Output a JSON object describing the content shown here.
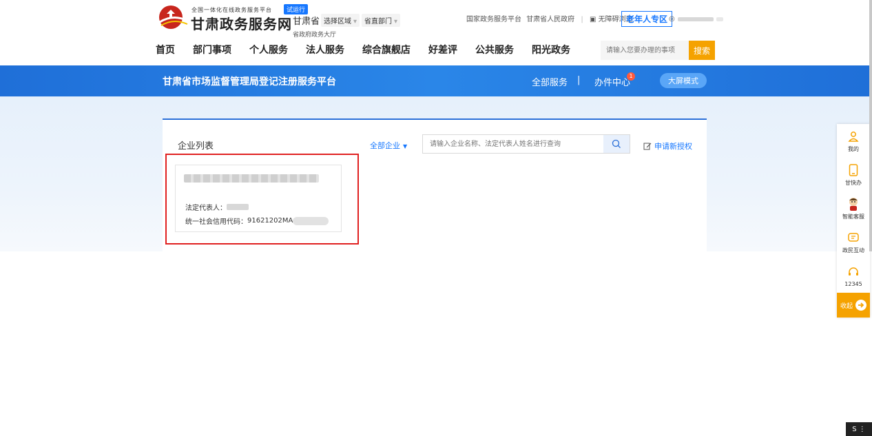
{
  "header": {
    "platform_sub": "全国一体化在线政务服务平台",
    "trial_badge": "试运行",
    "site_title": "甘肃政务服务网",
    "province": "甘肃省",
    "region_select": "选择区域",
    "dept_select": "省直部门",
    "hall_label": "省政府政务大厅",
    "top_links": [
      "国家政务服务平台",
      "甘肃省人民政府",
      "无障碍浏览"
    ],
    "senior_zone": "老年人专区",
    "nav": [
      "首页",
      "部门事项",
      "个人服务",
      "法人服务",
      "综合旗舰店",
      "好差评",
      "公共服务",
      "阳光政务"
    ],
    "search_placeholder": "请输入您要办理的事项",
    "search_button": "搜索"
  },
  "banner": {
    "title": "甘肃省市场监督管理局登记注册服务平台",
    "all_services": "全部服务",
    "office_center": "办件中心",
    "office_badge": "1",
    "big_screen": "大屏模式"
  },
  "panel": {
    "title": "企业列表",
    "filter": "全部企业",
    "search_placeholder": "请输入企业名称、法定代表人姓名进行查询",
    "apply_link": "申请新授权",
    "company": {
      "legal_rep_label": "法定代表人：",
      "credit_code_label": "统一社会信用代码：",
      "credit_code_visible": "91621202MA"
    }
  },
  "sidebar": {
    "items": [
      {
        "label": "我的",
        "icon": "user-icon"
      },
      {
        "label": "甘快办",
        "icon": "phone-icon"
      },
      {
        "label": "智能客服",
        "icon": "robot-icon"
      },
      {
        "label": "政民互动",
        "icon": "chat-icon"
      },
      {
        "label": "12345",
        "icon": "headset-icon"
      }
    ],
    "collapse_label": "收起"
  },
  "colors": {
    "primary_blue": "#1677ff",
    "banner_blue": "#2a86e8",
    "accent_orange": "#f5a200",
    "highlight_red": "#e02020"
  }
}
